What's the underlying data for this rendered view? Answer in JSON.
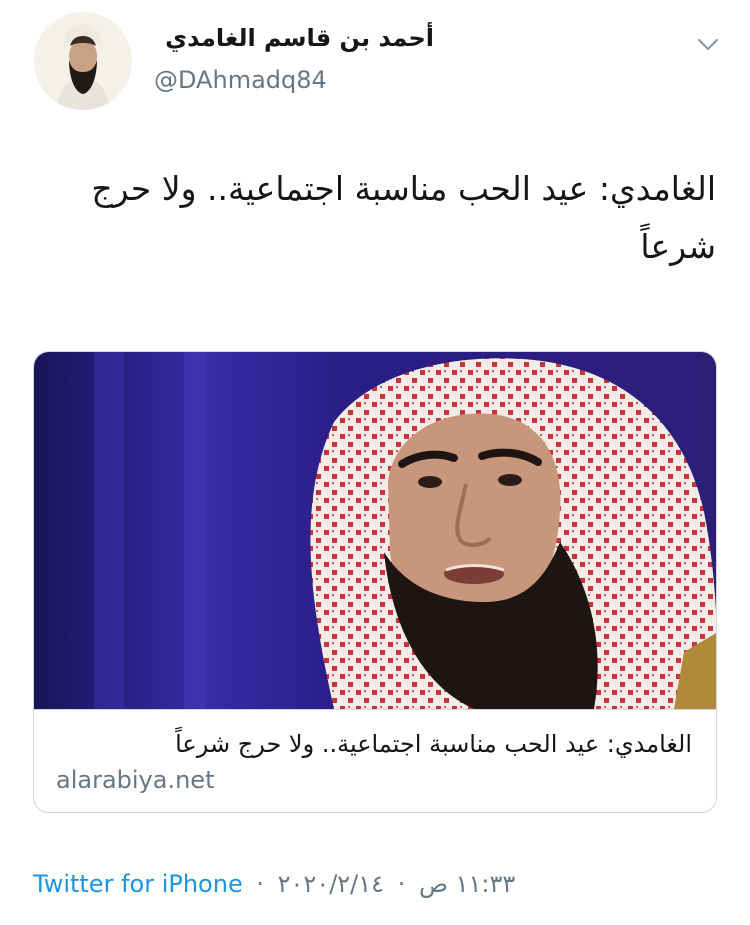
{
  "user": {
    "display_name": "أحمد بن قاسم الغامدي",
    "handle": "@DAhmadq84"
  },
  "icons": {
    "caret": "chevron-down-icon",
    "avatar": "avatar-photo"
  },
  "tweet": {
    "text": "الغامدي: عيد الحب مناسبة اجتماعية.. ولا حرج شرعاً"
  },
  "card": {
    "title": "الغامدي: عيد الحب مناسبة اجتماعية.. ولا حرج شرعاً",
    "domain": "alarabiya.net"
  },
  "meta": {
    "source": "Twitter for iPhone",
    "separator": "·",
    "date": "٢٠٢٠/٢/١٤",
    "time": "١١:٣٣ ص"
  },
  "colors": {
    "link": "#1b95e0",
    "secondary_text": "#657786",
    "border": "#ccd6dd"
  }
}
